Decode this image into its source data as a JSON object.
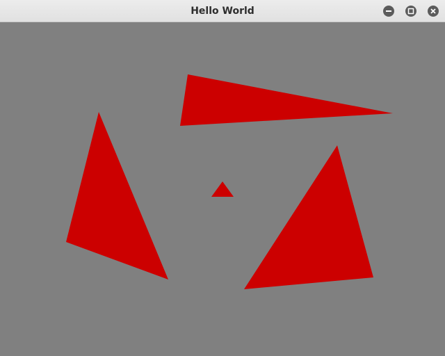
{
  "window": {
    "title": "Hello World"
  },
  "controls": {
    "minimize_icon": "minimize-icon",
    "maximize_icon": "maximize-icon",
    "close_icon": "close-icon"
  },
  "scene": {
    "background_color": "#808080",
    "shape_color": "#cc0000"
  }
}
